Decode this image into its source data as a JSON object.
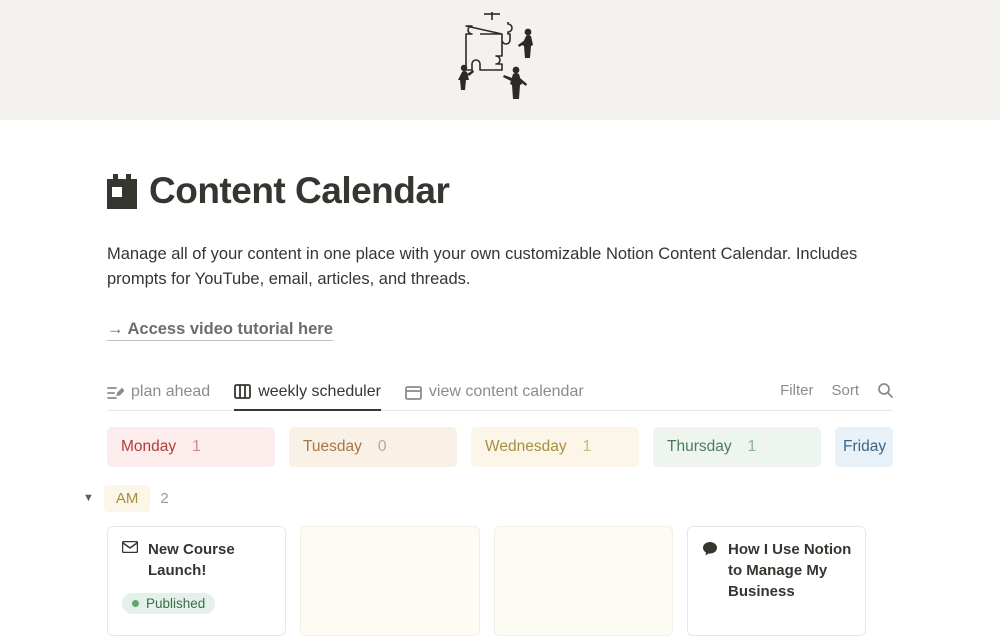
{
  "page": {
    "title": "Content Calendar",
    "description": "Manage all of your content in one place with your own customizable Notion Content Calendar. Includes prompts for YouTube, email, articles, and threads.",
    "tutorial_link": "→ Access video tutorial here"
  },
  "tabs": {
    "plan": "plan ahead",
    "weekly": "weekly scheduler",
    "calendar": "view content calendar"
  },
  "actions": {
    "filter": "Filter",
    "sort": "Sort"
  },
  "days": [
    {
      "label": "Monday",
      "count": "1"
    },
    {
      "label": "Tuesday",
      "count": "0"
    },
    {
      "label": "Wednesday",
      "count": "1"
    },
    {
      "label": "Thursday",
      "count": "1"
    },
    {
      "label": "Friday"
    }
  ],
  "group": {
    "label": "AM",
    "count": "2"
  },
  "cards": {
    "monday": {
      "title": "New Course Launch!",
      "status": "Published"
    },
    "thursday": {
      "title": "How I Use Notion to Manage My Business"
    }
  }
}
